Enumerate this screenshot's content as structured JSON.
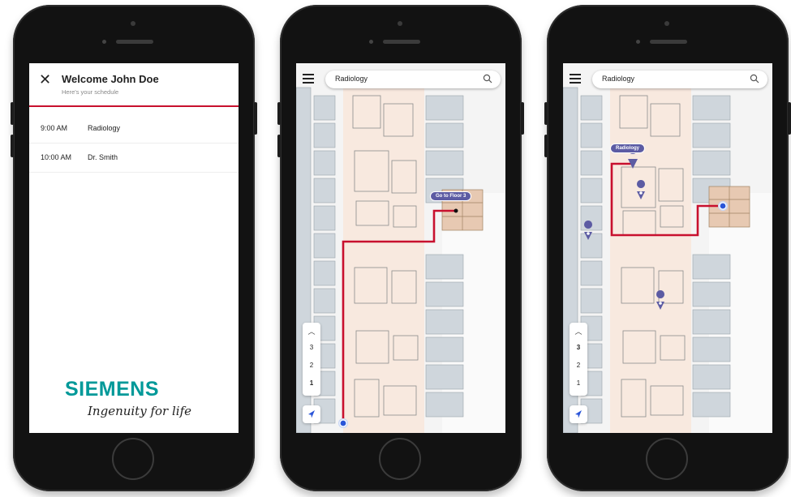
{
  "schedule_screen": {
    "title": "Welcome John Doe",
    "subtitle": "Here's your schedule",
    "appointments": [
      {
        "time": "9:00 AM",
        "place": "Radiology"
      },
      {
        "time": "10:00 AM",
        "place": "Dr. Smith"
      }
    ],
    "logo": "SIEMENS",
    "tagline": "Ingenuity for life"
  },
  "map_screen_1": {
    "search_value": "Radiology",
    "floor_button_label": "Go to Floor 3",
    "floors": [
      "3",
      "2",
      "1"
    ],
    "active_floor": "1"
  },
  "map_screen_2": {
    "search_value": "Radiology",
    "destination_label": "Radiology",
    "floors": [
      "3",
      "2",
      "1"
    ],
    "active_floor": "3"
  },
  "colors": {
    "route": "#c8102e",
    "accent": "#5c5ba3",
    "brand": "#009999"
  }
}
